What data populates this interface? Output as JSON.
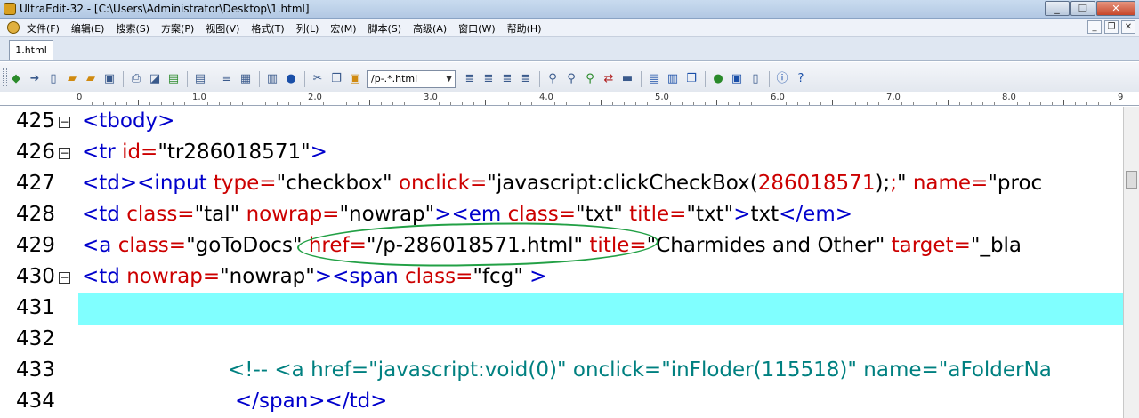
{
  "window": {
    "title": "UltraEdit-32 - [C:\\Users\\Administrator\\Desktop\\1.html]",
    "controls": [
      "_",
      "❐",
      "✕"
    ]
  },
  "menubar": {
    "items": [
      "文件(F)",
      "编辑(E)",
      "搜索(S)",
      "方案(P)",
      "视图(V)",
      "格式(T)",
      "列(L)",
      "宏(M)",
      "脚本(S)",
      "高级(A)",
      "窗口(W)",
      "帮助(H)"
    ],
    "mdi_controls": [
      "_",
      "❐",
      "✕"
    ]
  },
  "tabs": [
    {
      "label": "1.html"
    }
  ],
  "toolbar": {
    "search_value": "/p-.*.html"
  },
  "ruler": {
    "labels": [
      "0",
      "1,0",
      "2,0",
      "3,0",
      "4,0",
      "5,0",
      "6,0",
      "7,0",
      "8,0",
      "9"
    ]
  },
  "editor": {
    "highlight_color": "#80ffff",
    "lines": [
      {
        "num": "425",
        "fold": true,
        "tokens": [
          [
            "t",
            "<tbody>"
          ]
        ]
      },
      {
        "num": "426",
        "fold": true,
        "tokens": [
          [
            "t",
            "<tr "
          ],
          [
            "a",
            "id="
          ],
          [
            "s",
            "\"tr286018571\""
          ],
          [
            "t",
            ">"
          ]
        ]
      },
      {
        "num": "427",
        "fold": false,
        "tokens": [
          [
            "t",
            "<td><input "
          ],
          [
            "a",
            "type="
          ],
          [
            "s",
            "\"checkbox\" "
          ],
          [
            "a",
            "onclick="
          ],
          [
            "s",
            "\"javascript:clickCheckBox("
          ],
          [
            "a",
            "286018571"
          ],
          [
            "s",
            ");"
          ],
          [
            "a",
            ";"
          ],
          [
            "s",
            "\" "
          ],
          [
            "a",
            "name="
          ],
          [
            "s",
            "\"proc"
          ]
        ]
      },
      {
        "num": "428",
        "fold": false,
        "tokens": [
          [
            "t",
            "<td "
          ],
          [
            "a",
            "class="
          ],
          [
            "s",
            "\"tal\" "
          ],
          [
            "a",
            "nowrap="
          ],
          [
            "s",
            "\"nowrap\""
          ],
          [
            "t",
            "><em "
          ],
          [
            "a",
            "class="
          ],
          [
            "s",
            "\"txt\" "
          ],
          [
            "a",
            "title="
          ],
          [
            "s",
            "\"txt\""
          ],
          [
            "t",
            ">"
          ],
          [
            "s",
            "txt"
          ],
          [
            "t",
            "</em>"
          ]
        ]
      },
      {
        "num": "429",
        "fold": false,
        "tokens": [
          [
            "t",
            "<a "
          ],
          [
            "a",
            "class="
          ],
          [
            "s",
            "\"goToDocs\" "
          ],
          [
            "a",
            "href="
          ],
          [
            "s",
            "\"/p-286018571.html\" "
          ],
          [
            "a",
            "title="
          ],
          [
            "s",
            "\"Charmides and Other\" "
          ],
          [
            "a",
            "target="
          ],
          [
            "s",
            "\"_bla"
          ]
        ]
      },
      {
        "num": "430",
        "fold": true,
        "tokens": [
          [
            "t",
            "<td "
          ],
          [
            "a",
            "nowrap="
          ],
          [
            "s",
            "\"nowrap\""
          ],
          [
            "t",
            "><span "
          ],
          [
            "a",
            "class="
          ],
          [
            "s",
            "\"fcg\" "
          ],
          [
            "t",
            ">"
          ]
        ]
      },
      {
        "num": "431",
        "fold": false,
        "highlight": true,
        "tokens": []
      },
      {
        "num": "432",
        "fold": false,
        "tokens": []
      },
      {
        "num": "433",
        "fold": false,
        "indent": 164,
        "tokens": [
          [
            "c",
            "<!-- <a href=\"javascript:void(0)\" onclick=\"inFloder(115518)\" name=\"aFolderNa"
          ]
        ]
      },
      {
        "num": "434",
        "fold": false,
        "indent": 172,
        "tokens": [
          [
            "t",
            "</span></td>"
          ]
        ]
      }
    ]
  }
}
